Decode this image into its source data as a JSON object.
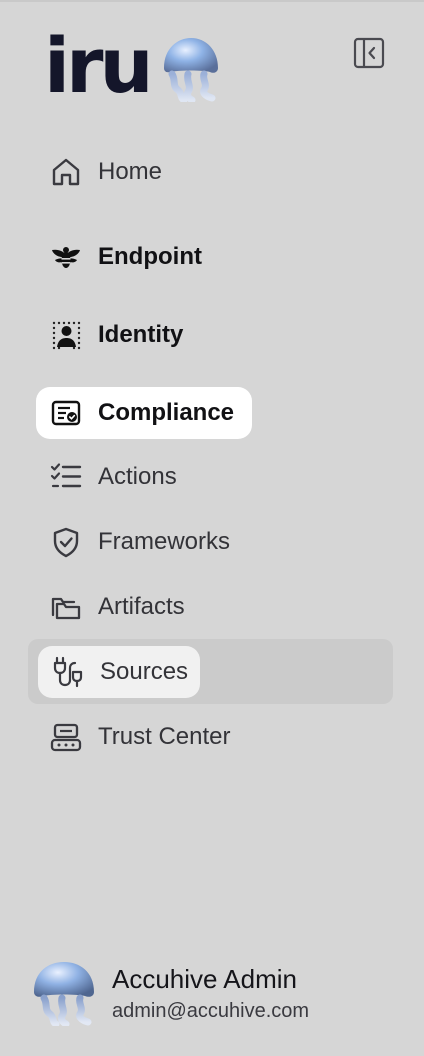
{
  "brand": {
    "name": "iru"
  },
  "nav": {
    "items": [
      {
        "label": "Home",
        "icon": "home-icon"
      },
      {
        "label": "Endpoint",
        "icon": "bee-icon"
      },
      {
        "label": "Identity",
        "icon": "identity-icon"
      },
      {
        "label": "Compliance",
        "icon": "certificate-icon"
      },
      {
        "label": "Actions",
        "icon": "checklist-icon"
      },
      {
        "label": "Frameworks",
        "icon": "shield-check-icon"
      },
      {
        "label": "Artifacts",
        "icon": "folders-icon"
      },
      {
        "label": "Sources",
        "icon": "plug-icon"
      },
      {
        "label": "Trust Center",
        "icon": "trust-center-icon"
      }
    ],
    "active": "Compliance",
    "hovered": "Sources"
  },
  "user": {
    "name": "Accuhive Admin",
    "email": "admin@accuhive.com"
  },
  "colors": {
    "background": "#d6d6d6",
    "active_bg": "#ffffff",
    "hover_row": "#cbcbcb",
    "logo": "#14162a"
  }
}
